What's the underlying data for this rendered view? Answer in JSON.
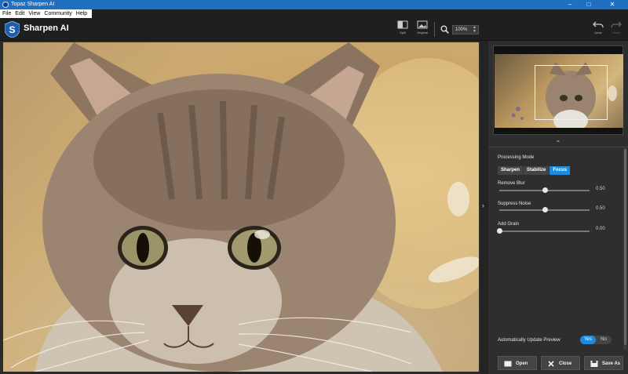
{
  "window": {
    "title": "Topaz Sharpen AI",
    "controls": [
      "minimize-icon",
      "maximize-icon",
      "close-icon"
    ]
  },
  "menu": [
    "File",
    "Edit",
    "View",
    "Community",
    "Help"
  ],
  "toolbar": {
    "app_name": "Sharpen AI",
    "split_label": "Split",
    "original_label": "Original",
    "zoom_value": "100%",
    "undo_label": "Undo",
    "redo_label": "Redo"
  },
  "panel": {
    "processing_mode_label": "Processing Mode",
    "modes": [
      "Sharpen",
      "Stabilize",
      "Focus"
    ],
    "active_mode": "Focus",
    "sliders": [
      {
        "label": "Remove Blur",
        "value": "0.50",
        "fraction": 0.5
      },
      {
        "label": "Suppress Noise",
        "value": "0.50",
        "fraction": 0.5
      },
      {
        "label": "Add Grain",
        "value": "0.00",
        "fraction": 0.0
      }
    ],
    "auto_update_label": "Automatically Update Preview",
    "toggle": {
      "yes": "Yes",
      "no": "No",
      "selected": "Yes"
    }
  },
  "footer": {
    "open_label": "Open",
    "close_label": "Close",
    "save_as_label": "Save As"
  },
  "colors": {
    "titlebar": "#1f6fc2",
    "accent": "#1d8ce0",
    "panel": "#2e2e2e",
    "toolbar": "#1f1f1f"
  }
}
